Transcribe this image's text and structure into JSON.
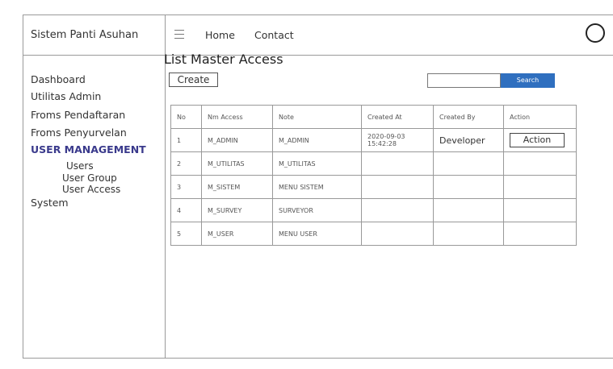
{
  "header": {
    "app_title": "Sistem Panti Asuhan",
    "nav": [
      {
        "label": "Home"
      },
      {
        "label": "Contact"
      }
    ]
  },
  "sidebar": {
    "items": [
      {
        "label": "Dashboard"
      },
      {
        "label": "Utilitas Admin"
      },
      {
        "label": "Froms Pendaftaran"
      },
      {
        "label": "Froms Penyurvelan"
      },
      {
        "label": "USER MANAGEMENT"
      },
      {
        "label": "Users"
      },
      {
        "label": "User Group"
      },
      {
        "label": "User Access"
      },
      {
        "label": "System"
      }
    ]
  },
  "main": {
    "title": "List Master Access",
    "create_label": "Create",
    "search_value": "",
    "search_label": "Search",
    "table": {
      "headers": [
        "No",
        "Nm Access",
        "Note",
        "Created At",
        "Created By",
        "Action"
      ],
      "rows": [
        {
          "no": "1",
          "nm_access": "M_ADMIN",
          "note": "M_ADMIN",
          "created_at": "2020-09-03 15:42:28",
          "created_by": "Developer",
          "action": "Action"
        },
        {
          "no": "2",
          "nm_access": "M_UTILITAS",
          "note": "M_UTILITAS",
          "created_at": "",
          "created_by": "",
          "action": ""
        },
        {
          "no": "3",
          "nm_access": "M_SISTEM",
          "note": "MENU SISTEM",
          "created_at": "",
          "created_by": "",
          "action": ""
        },
        {
          "no": "4",
          "nm_access": "M_SURVEY",
          "note": "SURVEYOR",
          "created_at": "",
          "created_by": "",
          "action": ""
        },
        {
          "no": "5",
          "nm_access": "M_USER",
          "note": "MENU USER",
          "created_at": "",
          "created_by": "",
          "action": ""
        }
      ]
    }
  },
  "colors": {
    "accent": "#2f6fbf",
    "sidebar_active": "#3a3a8c"
  },
  "icons": {
    "menu": "hamburger-icon",
    "profile": "circle-icon"
  }
}
